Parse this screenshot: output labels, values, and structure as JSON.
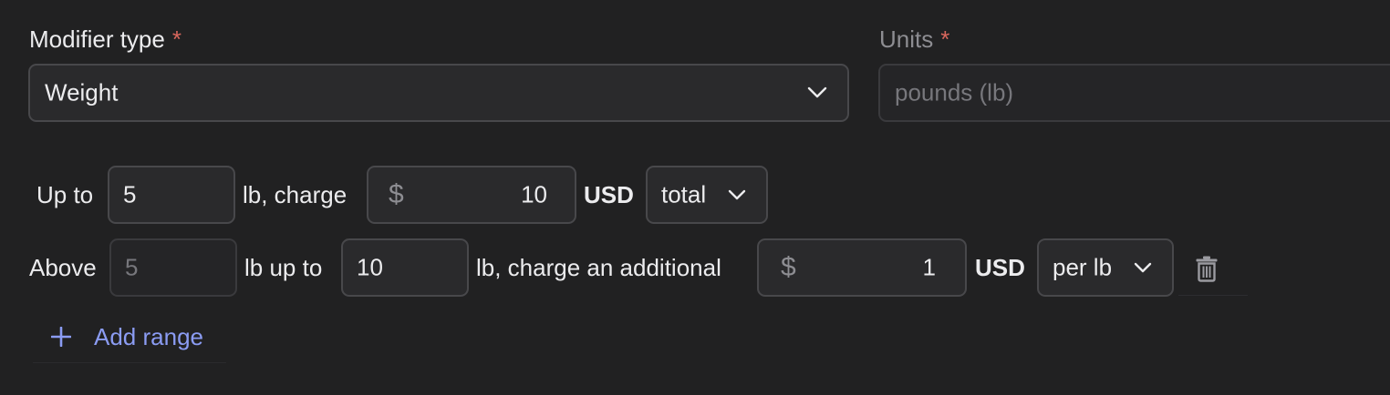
{
  "modifier_type": {
    "label": "Modifier type",
    "required_mark": "*",
    "value": "Weight"
  },
  "units": {
    "label": "Units",
    "required_mark": "*",
    "value": "pounds (lb)"
  },
  "range1": {
    "prefix": "Up to",
    "upper": "5",
    "mid_text": "lb, charge",
    "currency_symbol": "$",
    "amount": "10",
    "currency": "USD",
    "basis": "total"
  },
  "range2": {
    "prefix": "Above",
    "lower": "5",
    "mid_text1": "lb up to",
    "upper": "10",
    "mid_text2": "lb, charge an additional",
    "currency_symbol": "$",
    "amount": "1",
    "currency": "USD",
    "basis": "per lb"
  },
  "add_range": {
    "icon": "plus-icon",
    "label": "Add range"
  },
  "colors": {
    "background": "#212122",
    "accent": "#8b9cf3",
    "required": "#d9675d"
  }
}
